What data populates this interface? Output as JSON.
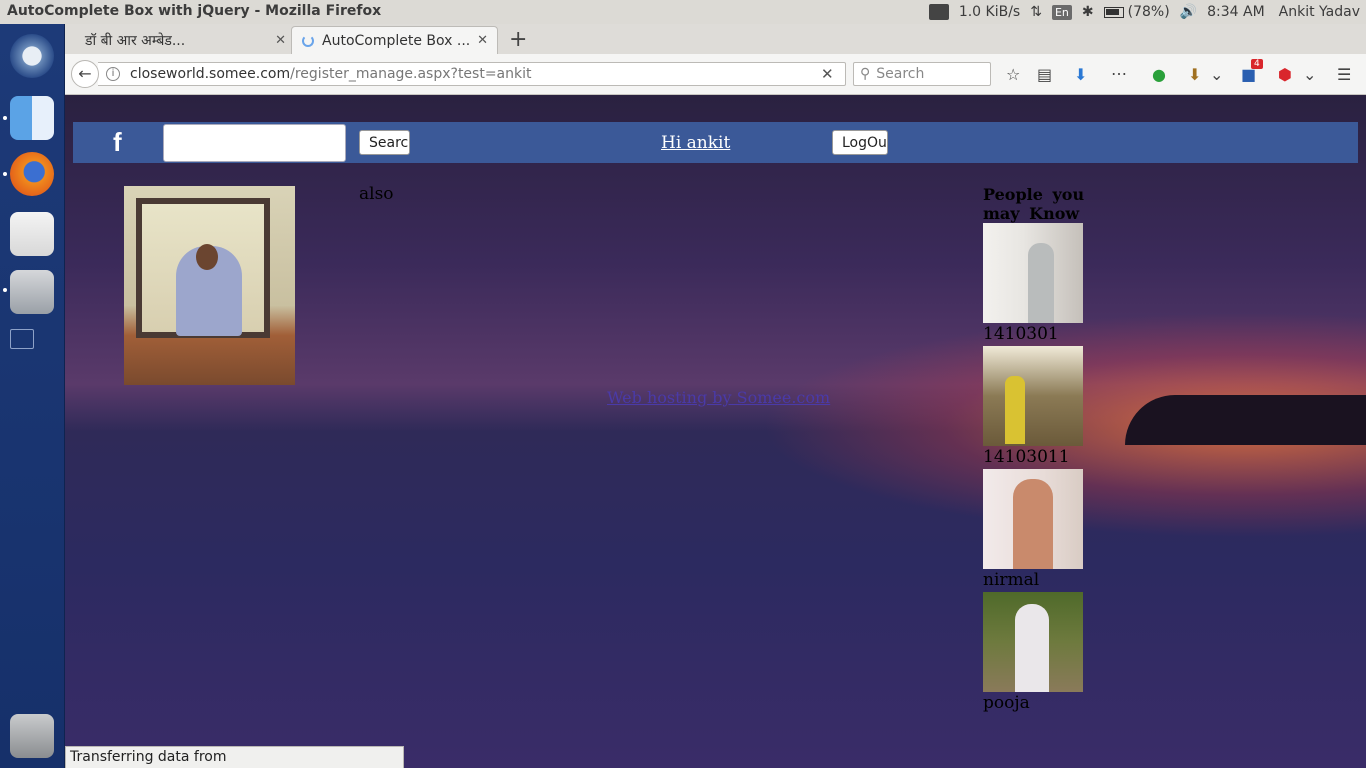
{
  "window": {
    "title": "AutoComplete Box with jQuery - Mozilla Firefox"
  },
  "panel": {
    "network_speed": "1.0 KiB/s",
    "language": "En",
    "battery": "(78%)",
    "time": "8:34 AM",
    "user": "Ankit Yadav"
  },
  "tabs": [
    {
      "label": "डॉ बी आर अम्बेड..."
    },
    {
      "label": "AutoComplete Box ..."
    }
  ],
  "navbar": {
    "url_host": "closeworld.somee.com",
    "url_path": "/register_manage.aspx?test=ankit",
    "search_placeholder": "Search",
    "badge_count": "4"
  },
  "page": {
    "header": {
      "logo": "f",
      "search_button": "Search",
      "greeting": "Hi ankit",
      "logout_button": "LogOut"
    },
    "also_text": "also",
    "hosting_link": "Web hosting by Somee.com",
    "people": {
      "title": "People you may Know",
      "list": [
        {
          "name": "1410301"
        },
        {
          "name": "14103011"
        },
        {
          "name": "nirmal"
        },
        {
          "name": "pooja"
        }
      ]
    }
  },
  "status": {
    "text": "Transferring data from closeworld.somee.com..."
  }
}
